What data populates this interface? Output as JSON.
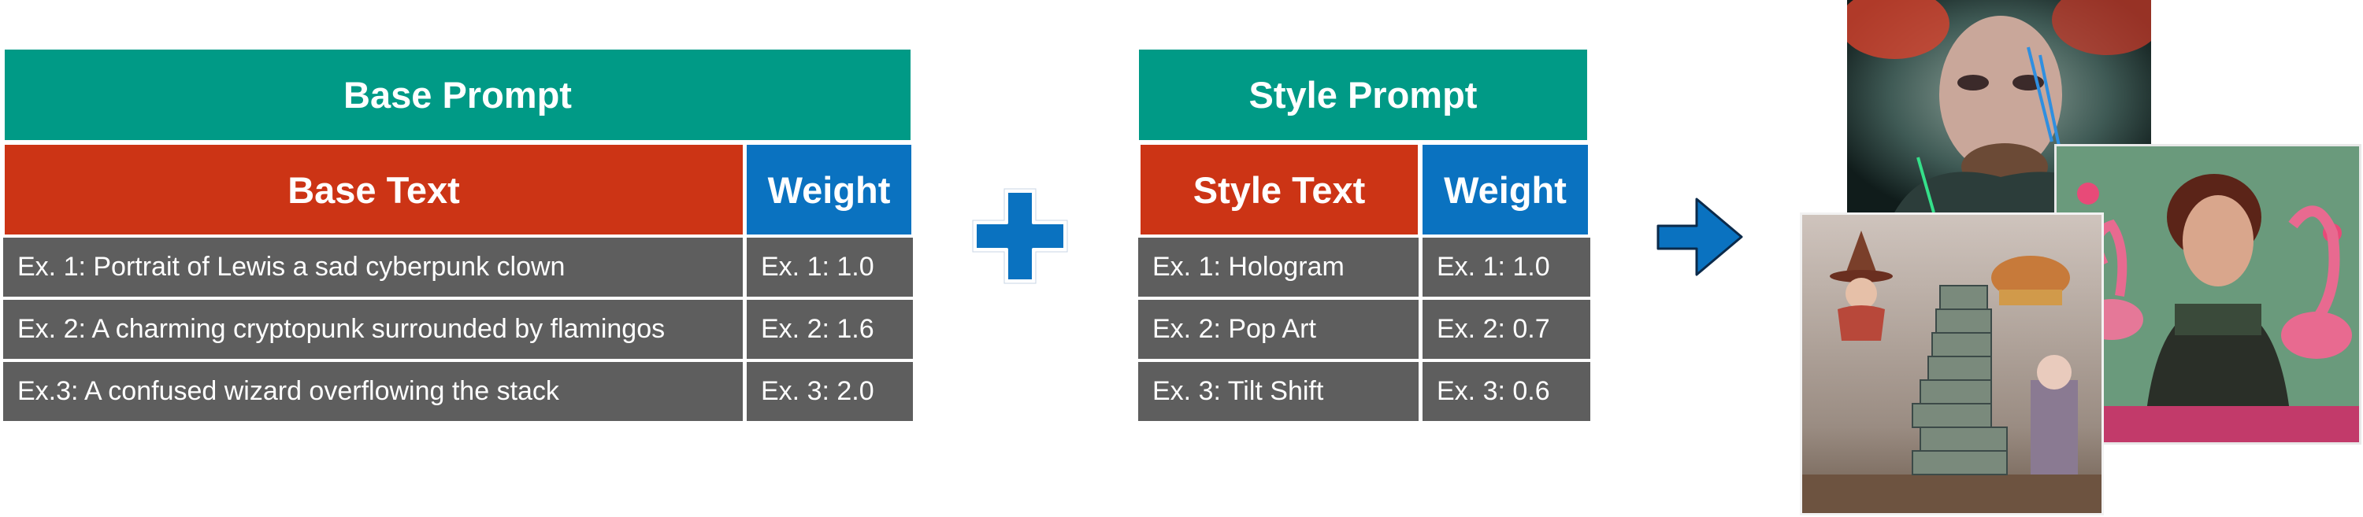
{
  "base_prompt": {
    "title": "Base Prompt",
    "text_header": "Base Text",
    "weight_header": "Weight",
    "rows": [
      {
        "text": "Ex. 1: Portrait of Lewis a sad cyberpunk clown",
        "weight": "Ex. 1: 1.0"
      },
      {
        "text": "Ex. 2: A charming cryptopunk surrounded by flamingos",
        "weight": "Ex. 2: 1.6"
      },
      {
        "text": "Ex.3: A confused wizard overflowing the stack",
        "weight": "Ex. 3: 2.0"
      }
    ]
  },
  "style_prompt": {
    "title": "Style Prompt",
    "text_header": "Style Text",
    "weight_header": "Weight",
    "rows": [
      {
        "text": "Ex. 1: Hologram",
        "weight": "Ex. 1: 1.0"
      },
      {
        "text": "Ex. 2: Pop Art",
        "weight": "Ex. 2: 0.7"
      },
      {
        "text": "Ex. 3: Tilt Shift",
        "weight": "Ex. 3: 0.6"
      }
    ]
  },
  "operators": {
    "plus_icon": "plus-icon",
    "arrow_icon": "arrow-right-icon"
  },
  "images": [
    {
      "name": "hologram-clown-portrait"
    },
    {
      "name": "pop-art-flamingo-portrait"
    },
    {
      "name": "tilt-shift-wizard-stack"
    }
  ],
  "colors": {
    "title_bar": "#009a86",
    "text_header": "#cc3415",
    "weight_header": "#0a72c0",
    "cell": "#5e5e5e",
    "operator": "#0a72c0"
  }
}
